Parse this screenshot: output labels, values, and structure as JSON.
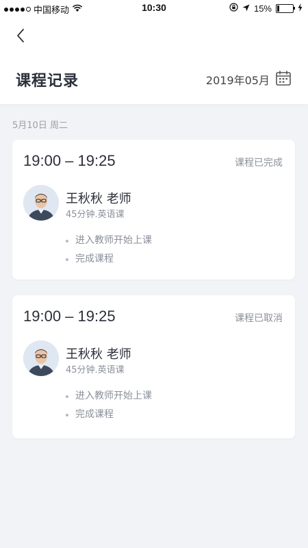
{
  "status_bar": {
    "carrier": "中国移动",
    "time": "10:30",
    "battery": "15%",
    "battery_level": 0.15
  },
  "header": {
    "title": "课程记录",
    "month": "2019年05月"
  },
  "date_label": "5月10日 周二",
  "lessons": [
    {
      "time_range": "19:00 – 19:25",
      "status": "课程已完成",
      "teacher_name": "王秋秋 老师",
      "subtitle": "45分钟.英语课",
      "steps": [
        "进入教师开始上课",
        "完成课程"
      ]
    },
    {
      "time_range": "19:00 – 19:25",
      "status": "课程已取消",
      "teacher_name": "王秋秋 老师",
      "subtitle": "45分钟.英语课",
      "steps": [
        "进入教师开始上课",
        "完成课程"
      ]
    }
  ],
  "icons": {
    "back": "chevron-left-icon",
    "calendar": "calendar-icon",
    "signal": "signal-dots-icon",
    "wifi": "wifi-icon",
    "lock": "rotation-lock-icon",
    "location": "location-arrow-icon",
    "battery": "battery-icon",
    "charging": "charging-bolt-icon"
  }
}
